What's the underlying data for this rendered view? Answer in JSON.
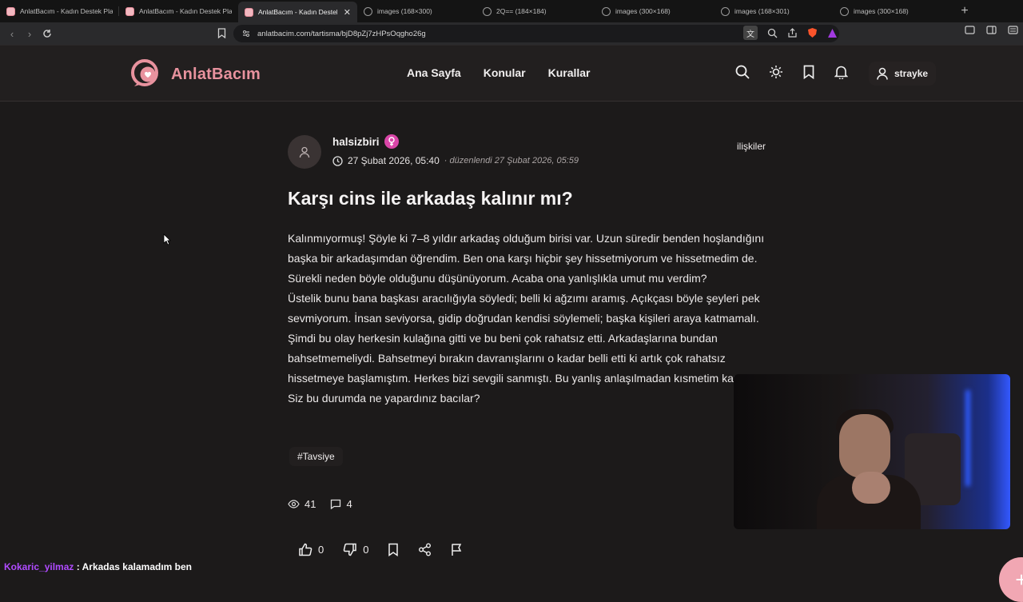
{
  "browser": {
    "tabs": [
      {
        "label": "AnlatBacım - Kadın Destek Pla",
        "favicon": "pink",
        "active": false
      },
      {
        "label": "AnlatBacım - Kadın Destek Pla",
        "favicon": "pink",
        "active": false
      },
      {
        "label": "AnlatBacım - Kadın Destek",
        "favicon": "pink",
        "active": true
      },
      {
        "label": "images (168×300)",
        "favicon": "globe",
        "active": false
      },
      {
        "label": "2Q== (184×184)",
        "favicon": "globe",
        "active": false
      },
      {
        "label": "images (300×168)",
        "favicon": "globe",
        "active": false
      },
      {
        "label": "images (168×301)",
        "favicon": "globe",
        "active": false
      },
      {
        "label": "images (300×168)",
        "favicon": "globe",
        "active": false
      }
    ],
    "new_tab": "+",
    "url": "anlatbacim.com/tartisma/bjD8pZj7zHPsOqgho26g"
  },
  "site": {
    "logo_text": "AnlatBacım",
    "brand_color": "#e8929e",
    "nav": [
      "Ana Sayfa",
      "Konular",
      "Kurallar"
    ],
    "username": "strayke"
  },
  "post": {
    "author": "halsizbiri",
    "date": "27 Şubat 2026, 05:40",
    "edited": "· düzenlendi 27 Şubat 2026, 05:59",
    "category": "ilişkiler",
    "title": "Karşı cins ile arkadaş kalınır mı?",
    "paragraphs": [
      "Kalınmıyormuş! Şöyle ki 7–8 yıldır arkadaş olduğum birisi var. Uzun süredir benden hoşlandığını başka bir arkadaşımdan öğrendim. Ben ona karşı hiçbir şey hissetmiyorum ve hissetmedim de. Sürekli neden böyle olduğunu düşünüyorum. Acaba ona yanlışlıkla umut mu verdim?",
      "Üstelik bunu bana başkası aracılığıyla söyledi; belli ki ağzımı aramış. Açıkçası böyle şeyleri pek sevmiyorum. İnsan seviyorsa, gidip doğrudan kendisi söylemeli; başka kişileri araya katmamalı. Şimdi bu olay herkesin kulağına gitti ve bu beni çok rahatsız etti. Arkadaşlarına bundan bahsetmemeliydi. Bahsetmeyi bırakın davranışlarını o kadar belli etti ki artık çok rahatsız hissetmeye başlamıştım. Herkes bizi sevgili sanmıştı. Bu yanlış anlaşılmadan kısmetim kapanmıştı. Siz bu durumda ne yapardınız bacılar?"
    ],
    "tag": "#Tavsiye",
    "views": "41",
    "comments": "4",
    "likes": "0",
    "dislikes": "0"
  },
  "chat": {
    "user": "Kokaric_yilmaz",
    "separator": " : ",
    "message": "Arkadas kalamadım ben"
  }
}
